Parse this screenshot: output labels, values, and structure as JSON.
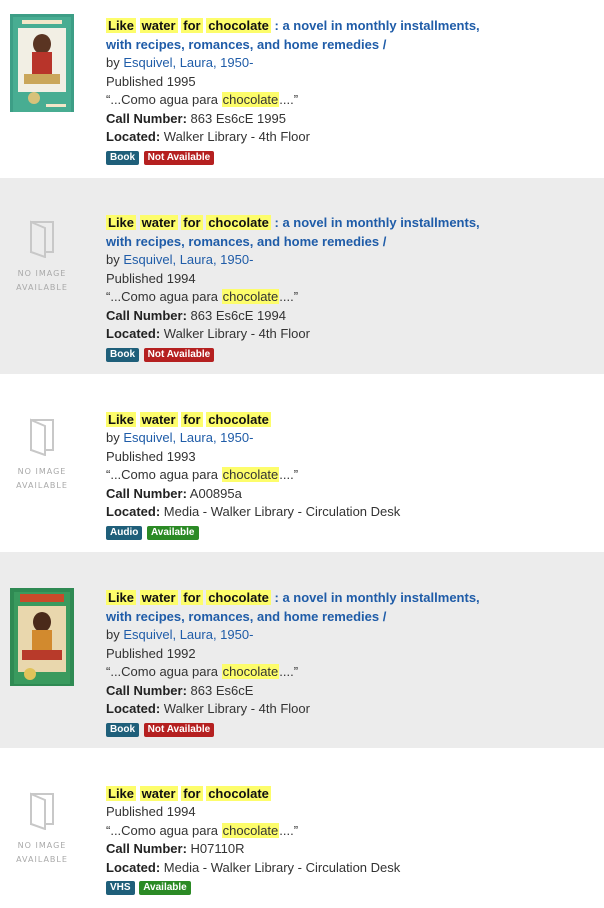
{
  "results": [
    {
      "title_words": [
        "Like",
        "water",
        "for",
        "chocolate"
      ],
      "title_rest_1": ": a novel in monthly installments,",
      "title_rest_2": "with recipes, romances, and home remedies /",
      "by_label": "by ",
      "author": "Esquivel, Laura, 1950-",
      "published": "Published 1995",
      "quote_pre": "“...Como agua para ",
      "quote_hl": "chocolate",
      "quote_post": "....”",
      "call_label": "Call Number:",
      "call_number": " 863 Es6cE 1995",
      "located_label": "Located:",
      "located": " Walker Library - 4th Floor",
      "format": "Book",
      "availability": "Not Available"
    },
    {
      "no_image_line1": "NO IMAGE",
      "no_image_line2": "AVAILABLE",
      "title_words": [
        "Like",
        "water",
        "for",
        "chocolate"
      ],
      "title_rest_1": ": a novel in monthly installments,",
      "title_rest_2": "with recipes, romances, and home remedies /",
      "by_label": "by ",
      "author": "Esquivel, Laura, 1950-",
      "published": "Published 1994",
      "quote_pre": "“...Como agua para ",
      "quote_hl": "chocolate",
      "quote_post": "....”",
      "call_label": "Call Number:",
      "call_number": " 863 Es6cE 1994",
      "located_label": "Located:",
      "located": " Walker Library - 4th Floor",
      "format": "Book",
      "availability": "Not Available"
    },
    {
      "no_image_line1": "NO IMAGE",
      "no_image_line2": "AVAILABLE",
      "title_words": [
        "Like",
        "water",
        "for",
        "chocolate"
      ],
      "by_label": "by ",
      "author": "Esquivel, Laura, 1950-",
      "published": "Published 1993",
      "quote_pre": "“...Como agua para ",
      "quote_hl": "chocolate",
      "quote_post": "....”",
      "call_label": "Call Number:",
      "call_number": " A00895a",
      "located_label": "Located:",
      "located": " Media - Walker Library - Circulation Desk",
      "format": "Audio",
      "availability": "Available"
    },
    {
      "title_words": [
        "Like",
        "water",
        "for",
        "chocolate"
      ],
      "title_rest_1": ": a novel in monthly installments,",
      "title_rest_2": "with recipes, romances, and home remedies /",
      "by_label": "by ",
      "author": "Esquivel, Laura, 1950-",
      "published": "Published 1992",
      "quote_pre": "“...Como agua para ",
      "quote_hl": "chocolate",
      "quote_post": "....”",
      "call_label": "Call Number:",
      "call_number": " 863 Es6cE",
      "located_label": "Located:",
      "located": " Walker Library - 4th Floor",
      "format": "Book",
      "availability": "Not Available"
    },
    {
      "no_image_line1": "NO IMAGE",
      "no_image_line2": "AVAILABLE",
      "title_words": [
        "Like",
        "water",
        "for",
        "chocolate"
      ],
      "published": "Published 1994",
      "quote_pre": "“...Como agua para ",
      "quote_hl": "chocolate",
      "quote_post": "....”",
      "call_label": "Call Number:",
      "call_number": " H07110R",
      "located_label": "Located:",
      "located": " Media - Walker Library - Circulation Desk",
      "format": "VHS",
      "availability": "Available"
    }
  ]
}
